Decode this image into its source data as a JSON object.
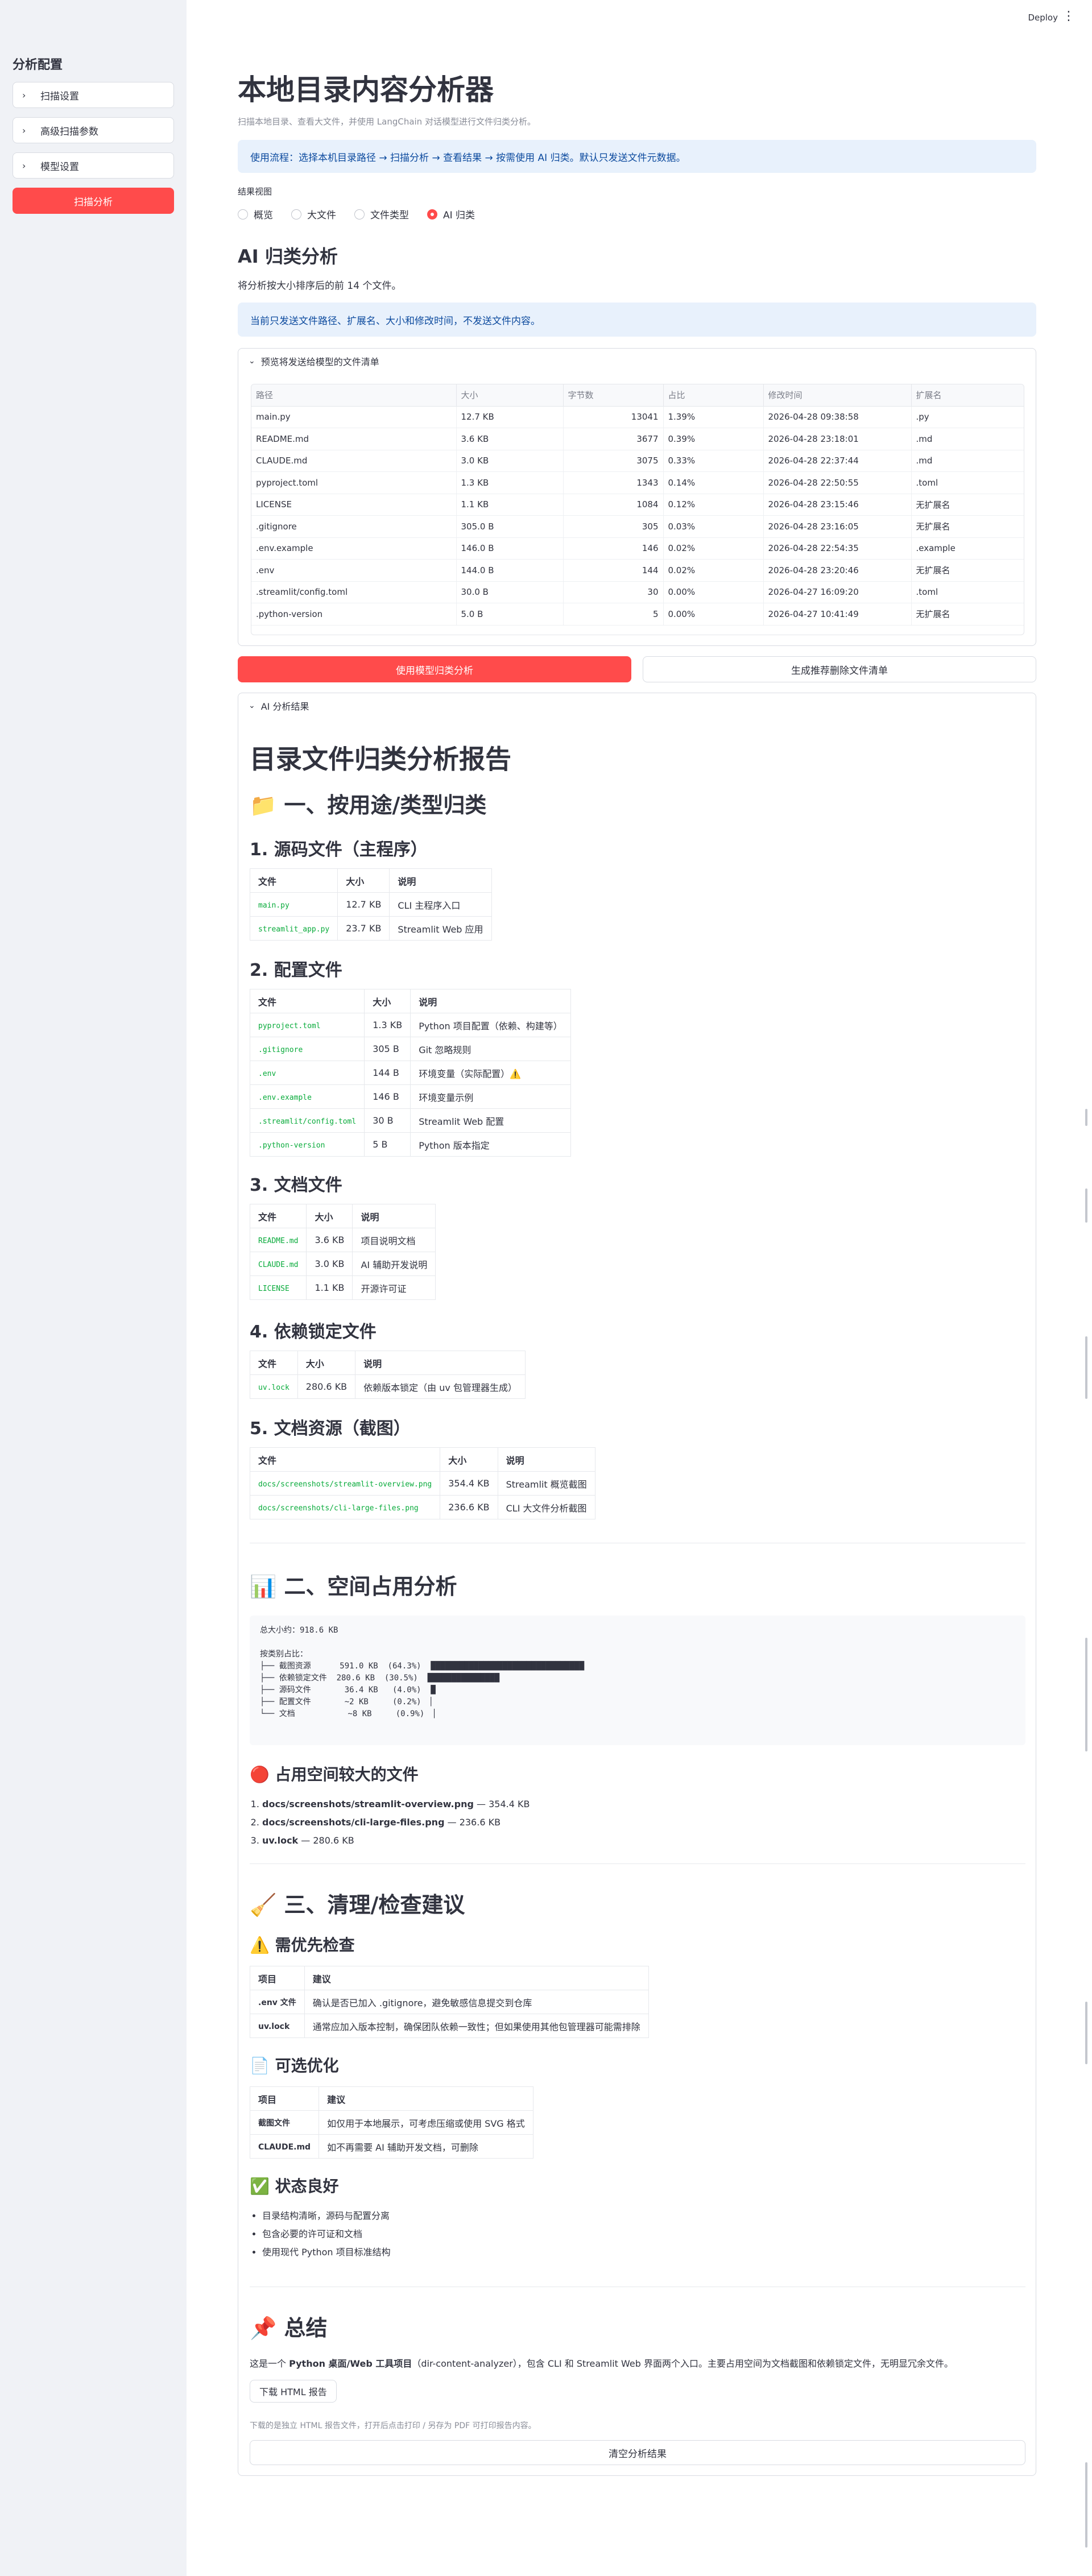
{
  "topbar": {
    "deploy": "Deploy",
    "menu_icon": "kebab-menu-icon"
  },
  "sidebar": {
    "title": "分析配置",
    "expanders": [
      "扫描设置",
      "高级扫描参数",
      "模型设置"
    ],
    "scan_button": "扫描分析"
  },
  "main": {
    "title": "本地目录内容分析器",
    "caption": "扫描本地目录、查看大文件，并使用 LangChain 对话模型进行文件归类分析。",
    "usage_info": "使用流程：选择本机目录路径 → 扫描分析 → 查看结果 → 按需使用 AI 归类。默认只发送文件元数据。",
    "result_view_label": "结果视图",
    "radio_options": [
      "概览",
      "大文件",
      "文件类型",
      "AI 归类"
    ],
    "radio_selected": "AI 归类",
    "ai_header": "AI 归类分析",
    "ai_desc": "将分析按大小排序后的前 14 个文件。",
    "ai_info": "当前只发送文件路径、扩展名、大小和修改时间，不发送文件内容。",
    "preview_expander": "预览将发送给模型的文件清单",
    "preview_columns": [
      "路径",
      "大小",
      "字节数",
      "占比",
      "修改时间",
      "扩展名"
    ],
    "preview_rows": [
      [
        "main.py",
        "12.7 KB",
        "13041",
        "1.39%",
        "2026-04-28 09:38:58",
        ".py"
      ],
      [
        "README.md",
        "3.6 KB",
        "3677",
        "0.39%",
        "2026-04-28 23:18:01",
        ".md"
      ],
      [
        "CLAUDE.md",
        "3.0 KB",
        "3075",
        "0.33%",
        "2026-04-28 22:37:44",
        ".md"
      ],
      [
        "pyproject.toml",
        "1.3 KB",
        "1343",
        "0.14%",
        "2026-04-28 22:50:55",
        ".toml"
      ],
      [
        "LICENSE",
        "1.1 KB",
        "1084",
        "0.12%",
        "2026-04-28 23:15:46",
        "无扩展名"
      ],
      [
        ".gitignore",
        "305.0 B",
        "305",
        "0.03%",
        "2026-04-28 23:16:05",
        "无扩展名"
      ],
      [
        ".env.example",
        "146.0 B",
        "146",
        "0.02%",
        "2026-04-28 22:54:35",
        ".example"
      ],
      [
        ".env",
        "144.0 B",
        "144",
        "0.02%",
        "2026-04-28 23:20:46",
        "无扩展名"
      ],
      [
        ".streamlit/config.toml",
        "30.0 B",
        "30",
        "0.00%",
        "2026-04-27 16:09:20",
        ".toml"
      ],
      [
        ".python-version",
        "5.0 B",
        "5",
        "0.00%",
        "2026-04-27 10:41:49",
        "无扩展名"
      ]
    ],
    "btn_classify": "使用模型归类分析",
    "btn_cleanup": "生成推荐删除文件清单",
    "result_expander": "AI 分析结果"
  },
  "report": {
    "title": "目录文件归类分析报告",
    "sec1": "📁 一、按用途/类型归类",
    "sub1": "1. 源码文件（主程序）",
    "t1_head": [
      "文件",
      "大小",
      "说明"
    ],
    "t1_rows": [
      [
        "main.py",
        "12.7 KB",
        "CLI 主程序入口"
      ],
      [
        "streamlit_app.py",
        "23.7 KB",
        "Streamlit Web 应用"
      ]
    ],
    "sub2": "2. 配置文件",
    "t2_head": [
      "文件",
      "大小",
      "说明"
    ],
    "t2_rows": [
      [
        "pyproject.toml",
        "1.3 KB",
        "Python 项目配置（依赖、构建等）"
      ],
      [
        ".gitignore",
        "305 B",
        "Git 忽略规则"
      ],
      [
        ".env",
        "144 B",
        "环境变量（实际配置）⚠️"
      ],
      [
        ".env.example",
        "146 B",
        "环境变量示例"
      ],
      [
        ".streamlit/config.toml",
        "30 B",
        "Streamlit Web 配置"
      ],
      [
        ".python-version",
        "5 B",
        "Python 版本指定"
      ]
    ],
    "sub3": "3. 文档文件",
    "t3_head": [
      "文件",
      "大小",
      "说明"
    ],
    "t3_rows": [
      [
        "README.md",
        "3.6 KB",
        "项目说明文档"
      ],
      [
        "CLAUDE.md",
        "3.0 KB",
        "AI 辅助开发说明"
      ],
      [
        "LICENSE",
        "1.1 KB",
        "开源许可证"
      ]
    ],
    "sub4": "4. 依赖锁定文件",
    "t4_head": [
      "文件",
      "大小",
      "说明"
    ],
    "t4_rows": [
      [
        "uv.lock",
        "280.6 KB",
        "依赖版本锁定（由 uv 包管理器生成）"
      ]
    ],
    "sub5": "5. 文档资源（截图）",
    "t5_head": [
      "文件",
      "大小",
      "说明"
    ],
    "t5_rows": [
      [
        "docs/screenshots/streamlit-overview.png",
        "354.4 KB",
        "Streamlit 概览截图"
      ],
      [
        "docs/screenshots/cli-large-files.png",
        "236.6 KB",
        "CLI 大文件分析截图"
      ]
    ],
    "sec2": "📊 二、空间占用分析",
    "space_pre": "总大小约：918.6 KB\n\n按类别占比：\n├── 截图资源      591.0 KB  (64.3%)  ████████████████████████████████\n├── 依赖锁定文件  280.6 KB  (30.5%)  ███████████████\n├── 源码文件       36.4 KB   (4.0%)  █\n├── 配置文件       ~2 KB     (0.2%)  ▏\n└── 文档           ~8 KB     (0.9%)  ▏",
    "big_title": "🔴 占用空间较大的文件",
    "big_items": [
      [
        "docs/screenshots/streamlit-overview.png",
        " — 354.4 KB"
      ],
      [
        "docs/screenshots/cli-large-files.png",
        " — 236.6 KB"
      ],
      [
        "uv.lock",
        " — 280.6 KB"
      ]
    ],
    "sec3": "🧹 三、清理/检查建议",
    "check_title": "⚠️ 需优先检查",
    "check_head": [
      "项目",
      "建议"
    ],
    "check_rows": [
      [
        ".env 文件",
        "确认是否已加入 .gitignore，避免敏感信息提交到仓库"
      ],
      [
        "uv.lock",
        "通常应加入版本控制，确保团队依赖一致性；但如果使用其他包管理器可能需排除"
      ]
    ],
    "opt_title": "📄 可选优化",
    "opt_head": [
      "项目",
      "建议"
    ],
    "opt_rows": [
      [
        "截图文件",
        "如仅用于本地展示，可考虑压缩或使用 SVG 格式"
      ],
      [
        "CLAUDE.md",
        "如不再需要 AI 辅助开发文档，可删除"
      ]
    ],
    "good_title": "✅ 状态良好",
    "good_items": [
      "目录结构清晰，源码与配置分离",
      "包含必要的许可证和文档",
      "使用现代 Python 项目标准结构"
    ],
    "sec4": "📌 总结",
    "summary_prefix": "这是一个 ",
    "summary_bold": "Python 桌面/Web 工具项目",
    "summary_rest": "（dir-content-analyzer），包含 CLI 和 Streamlit Web 界面两个入口。主要占用空间为文档截图和依赖锁定文件，无明显冗余文件。",
    "download_btn": "下载 HTML 报告",
    "download_note": "下载的是独立 HTML 报告文件，打开后点击打印 / 另存为 PDF 可打印报告内容。",
    "clear_btn": "清空分析结果"
  }
}
